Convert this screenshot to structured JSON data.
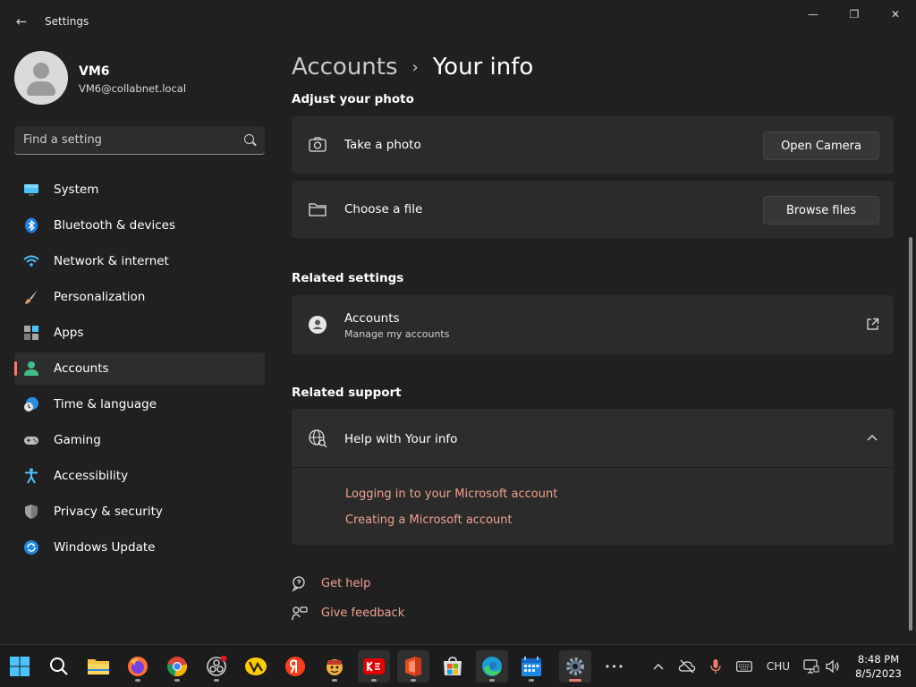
{
  "window": {
    "title": "Settings",
    "back_glyph": "←",
    "minimize_glyph": "—",
    "maximize_glyph": "❐",
    "close_glyph": "✕"
  },
  "user": {
    "name": "VM6",
    "email": "VM6@collabnet.local"
  },
  "search": {
    "placeholder": "Find a setting"
  },
  "nav": {
    "items": [
      {
        "label": "System",
        "icon": "monitor-icon"
      },
      {
        "label": "Bluetooth & devices",
        "icon": "bluetooth-icon"
      },
      {
        "label": "Network & internet",
        "icon": "wifi-icon"
      },
      {
        "label": "Personalization",
        "icon": "brush-icon"
      },
      {
        "label": "Apps",
        "icon": "apps-icon"
      },
      {
        "label": "Accounts",
        "icon": "person-icon",
        "active": true
      },
      {
        "label": "Time & language",
        "icon": "clock-globe-icon"
      },
      {
        "label": "Gaming",
        "icon": "gamepad-icon"
      },
      {
        "label": "Accessibility",
        "icon": "accessibility-icon"
      },
      {
        "label": "Privacy & security",
        "icon": "shield-icon"
      },
      {
        "label": "Windows Update",
        "icon": "update-icon"
      }
    ]
  },
  "breadcrumb": {
    "parent": "Accounts",
    "separator": "›",
    "current": "Your info"
  },
  "photo": {
    "heading": "Adjust your photo",
    "take_photo": {
      "label": "Take a photo",
      "button": "Open Camera"
    },
    "choose_file": {
      "label": "Choose a file",
      "button": "Browse files"
    }
  },
  "related_settings": {
    "heading": "Related settings",
    "accounts": {
      "title": "Accounts",
      "subtitle": "Manage my accounts"
    }
  },
  "related_support": {
    "heading": "Related support",
    "help": {
      "title": "Help with Your info",
      "expanded": true
    },
    "links": [
      "Logging in to your Microsoft account",
      "Creating a Microsoft account"
    ]
  },
  "footer_links": {
    "get_help": "Get help",
    "give_feedback": "Give feedback"
  },
  "taskbar": {
    "apps": [
      "start-icon",
      "search-icon",
      "file-explorer-icon",
      "firefox-icon",
      "chrome-icon",
      "obs-icon",
      "yandex-disk-icon",
      "yandex-browser-icon",
      "game-icon",
      "kis-icon",
      "office-icon",
      "store-icon",
      "edge-icon",
      "calendar-icon",
      "settings-icon",
      "more-icon"
    ],
    "more_glyph": "•••",
    "tray_chevron": "^",
    "language": "CHU",
    "time": "8:48 PM",
    "date": "8/5/2023"
  },
  "colors": {
    "background": "#202020",
    "card": "#2b2b2b",
    "accent": "#ee7f66",
    "link": "#f0a08c"
  }
}
